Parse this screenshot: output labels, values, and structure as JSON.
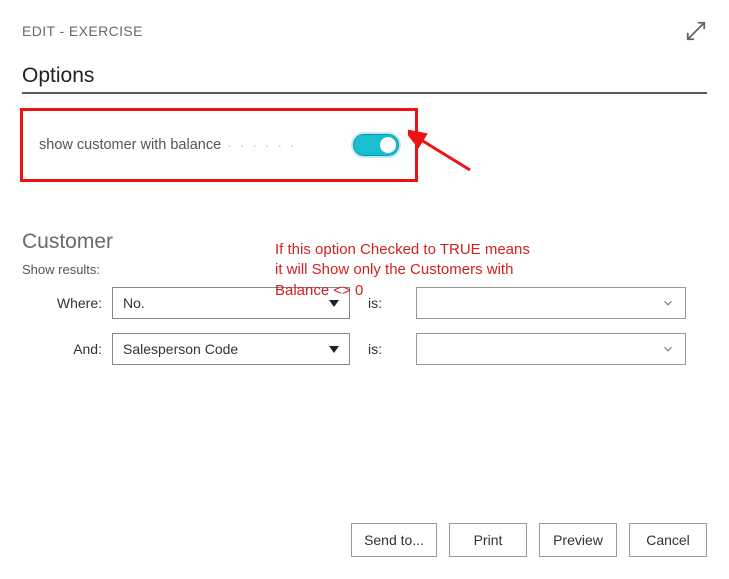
{
  "window": {
    "title": "EDIT - EXERCISE"
  },
  "sections": {
    "options": {
      "title": "Options",
      "toggle_label": "show customer with balance",
      "toggle_state": true
    },
    "customer": {
      "title": "Customer",
      "show_results_label": "Show results:",
      "rows": [
        {
          "label": "Where:",
          "field": "No.",
          "op_label": "is:",
          "value": ""
        },
        {
          "label": "And:",
          "field": "Salesperson Code",
          "op_label": "is:",
          "value": ""
        }
      ]
    }
  },
  "annotation": {
    "line1": "If this option Checked to TRUE means",
    "line2": "it will Show only the Customers with",
    "line3": "Balance <> 0"
  },
  "footer": {
    "send_to": "Send to...",
    "print": "Print",
    "preview": "Preview",
    "cancel": "Cancel"
  }
}
